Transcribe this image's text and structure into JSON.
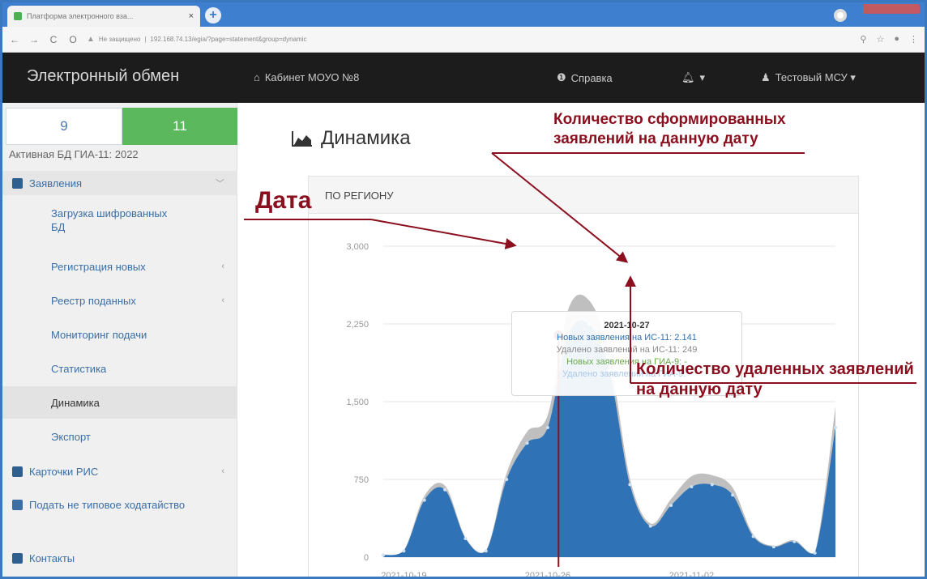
{
  "browser": {
    "tab_title": "Платформа электронного вза...",
    "tab_close": "×",
    "new_tab": "+",
    "nav_back": "←",
    "nav_forward": "→",
    "nav_reload": "C",
    "nav_home": "O",
    "url_security": "Не защищено",
    "url": "192.168.74.13/egia/?page=statement&group=dynamic",
    "icon_zoom": "search-icon",
    "icon_star": "star-icon",
    "icon_profile": "profile-icon"
  },
  "navbar": {
    "brand": "Электронный обмен",
    "cabinet": "Кабинет МОУО №8",
    "help": "Справка",
    "bell": "▾",
    "user": "Тестовый МСУ ▾",
    "cabinet_icon": "home-icon",
    "help_icon": "info-icon",
    "bell_icon": "bell-icon",
    "user_icon": "user-icon"
  },
  "sidebar": {
    "tab_9": "9",
    "tab_11": "11",
    "active_db": "Активная БД ГИА-11: 2022",
    "section_applications": "Заявления",
    "items": [
      {
        "label": "Загрузка шифрованных БД",
        "active": false
      },
      {
        "label": "Регистрация новых",
        "active": false
      },
      {
        "label": "Реестр поданных",
        "active": false
      },
      {
        "label": "Мониторинг подачи",
        "active": false
      },
      {
        "label": "Статистика",
        "active": false
      },
      {
        "label": "Динамика",
        "active": true
      },
      {
        "label": "Экспорт",
        "active": false
      }
    ],
    "section_cards": "Карточки РИС",
    "section_nontypical": "Подать не типовое ходатайство",
    "section_contacts": "Контакты",
    "chevron_open": "﹀",
    "chevron_left": "‹"
  },
  "main": {
    "title": "Динамика",
    "panel_title": "ПО РЕГИОНУ"
  },
  "chart_data": {
    "type": "area",
    "title": "",
    "xlabel": "",
    "ylabel": "",
    "ylim": [
      0,
      3000
    ],
    "yticks": [
      0,
      750,
      1500,
      2250,
      3000
    ],
    "ytick_labels": [
      "0",
      "750",
      "1,500",
      "2,250",
      "3,000"
    ],
    "xtick_labels": [
      "2021-10-19",
      "2021-10-26",
      "2021-11-02"
    ],
    "x": [
      "2021-10-18",
      "2021-10-19",
      "2021-10-20",
      "2021-10-21",
      "2021-10-22",
      "2021-10-23",
      "2021-10-24",
      "2021-10-25",
      "2021-10-26",
      "2021-10-27",
      "2021-10-28",
      "2021-10-29",
      "2021-10-30",
      "2021-10-31",
      "2021-11-01",
      "2021-11-02",
      "2021-11-03",
      "2021-11-04",
      "2021-11-05",
      "2021-11-06",
      "2021-11-07",
      "2021-11-08",
      "2021-11-09"
    ],
    "series": [
      {
        "name": "Новых заявления на ИС-11",
        "color": "#2f73b6",
        "values": [
          20,
          60,
          550,
          650,
          180,
          60,
          750,
          1100,
          1250,
          2141,
          2250,
          1800,
          700,
          300,
          500,
          680,
          700,
          600,
          200,
          100,
          150,
          40,
          1250
        ]
      },
      {
        "name": "Удалено заявлений на ИС-11",
        "color": "#b8b8b8",
        "values": [
          0,
          5,
          40,
          40,
          10,
          5,
          60,
          110,
          120,
          249,
          230,
          160,
          60,
          25,
          60,
          100,
          90,
          70,
          20,
          10,
          15,
          5,
          200
        ]
      }
    ],
    "tooltip": {
      "date": "2021-10-27",
      "line_new_11": "Новых заявления на ИС-11: 2.141",
      "line_del_11": "Удалено заявлений на ИС-11: 249",
      "line_new_9": "Новых заявления на ГИА-9: -",
      "line_del_9": "Удалено заявлений на ГИА-9: -"
    },
    "grid": true
  },
  "annotations": {
    "date_label": "Дата",
    "formed_label": "Количество сформированных заявлений на данную дату",
    "deleted_label": "Количество удаленных заявлений на данную дату",
    "color": "#8b0f1e"
  }
}
